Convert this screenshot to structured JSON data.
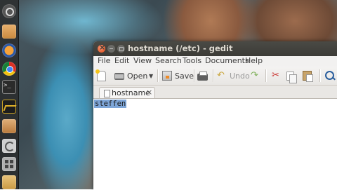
{
  "window": {
    "title": "hostname (/etc) - gedit"
  },
  "menubar": {
    "items": [
      "File",
      "Edit",
      "View",
      "Search",
      "Tools",
      "Documents",
      "Help"
    ]
  },
  "toolbar": {
    "open_label": "Open",
    "save_label": "Save",
    "undo_label": "Undo"
  },
  "tabs": [
    {
      "label": "hostname",
      "close": "×"
    }
  ],
  "editor": {
    "content": "steffen",
    "selection_color": "#7ea6d8"
  },
  "launcher": {
    "icons": [
      "dash-icon",
      "files-icon",
      "firefox-icon",
      "chrome-icon",
      "terminal-icon",
      "system-monitor-icon",
      "installer-icon",
      "software-updater-icon",
      "workspace-switcher-icon",
      "package-icon"
    ]
  },
  "colors": {
    "titlebar": "#3c3b37",
    "close_button": "#df4a16",
    "launcher_bg": "#282828"
  }
}
